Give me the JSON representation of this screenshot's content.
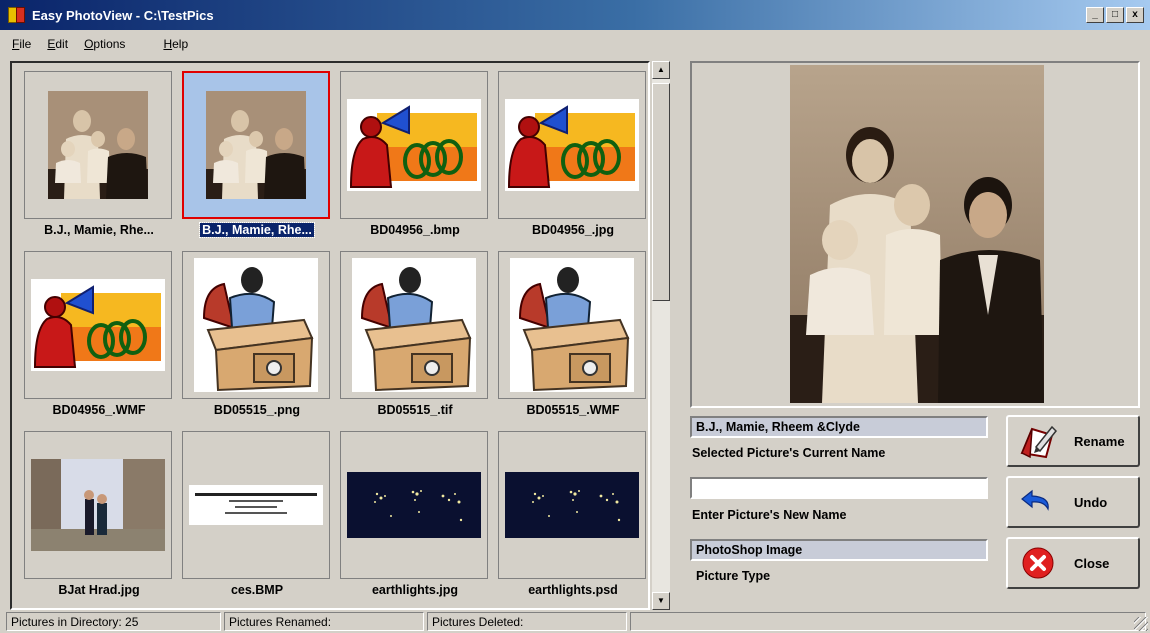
{
  "window": {
    "title": "Easy PhotoView - C:\\TestPics",
    "min": "_",
    "max": "□",
    "close": "x"
  },
  "menu": {
    "file": "File",
    "edit": "Edit",
    "options": "Options",
    "help": "Help"
  },
  "thumbnails": [
    {
      "label": "B.J., Mamie, Rhe...",
      "kind": "family-photo",
      "selected": false
    },
    {
      "label": "B.J., Mamie, Rhe...",
      "kind": "family-photo",
      "selected": true
    },
    {
      "label": "BD04956_.bmp",
      "kind": "megaphone-clipart",
      "selected": false
    },
    {
      "label": "BD04956_.jpg",
      "kind": "megaphone-clipart",
      "selected": false
    },
    {
      "label": "BD04956_.WMF",
      "kind": "megaphone-clipart",
      "selected": false
    },
    {
      "label": "BD05515_.png",
      "kind": "desk-clipart",
      "selected": false
    },
    {
      "label": "BD05515_.tif",
      "kind": "desk-clipart",
      "selected": false
    },
    {
      "label": "BD05515_.WMF",
      "kind": "desk-clipart",
      "selected": false
    },
    {
      "label": "BJat Hrad.jpg",
      "kind": "castle-photo",
      "selected": false
    },
    {
      "label": "ces.BMP",
      "kind": "business-card",
      "selected": false
    },
    {
      "label": "earthlights.jpg",
      "kind": "earth-night-map",
      "selected": false
    },
    {
      "label": "earthlights.psd",
      "kind": "earth-night-map",
      "selected": false
    }
  ],
  "info": {
    "current_name": "B.J., Mamie, Rheem &Clyde",
    "current_name_caption": "Selected Picture's Current Name",
    "new_name_value": "",
    "new_name_caption": "Enter Picture's New Name",
    "picture_type": "PhotoShop Image",
    "picture_type_caption": "Picture Type"
  },
  "buttons": {
    "rename": "Rename",
    "undo": "Undo",
    "close": "Close"
  },
  "status": {
    "pictures_in_directory": "Pictures in Directory:  25",
    "pictures_renamed": "Pictures Renamed:",
    "pictures_deleted": "Pictures Deleted:"
  },
  "icons": {
    "rename": "pencil-paper-icon",
    "undo": "undo-arrow-icon",
    "close": "close-circle-icon"
  },
  "colors": {
    "selection_border": "#e00000",
    "title_bar": "#0a246a",
    "close_red": "#e02020"
  }
}
